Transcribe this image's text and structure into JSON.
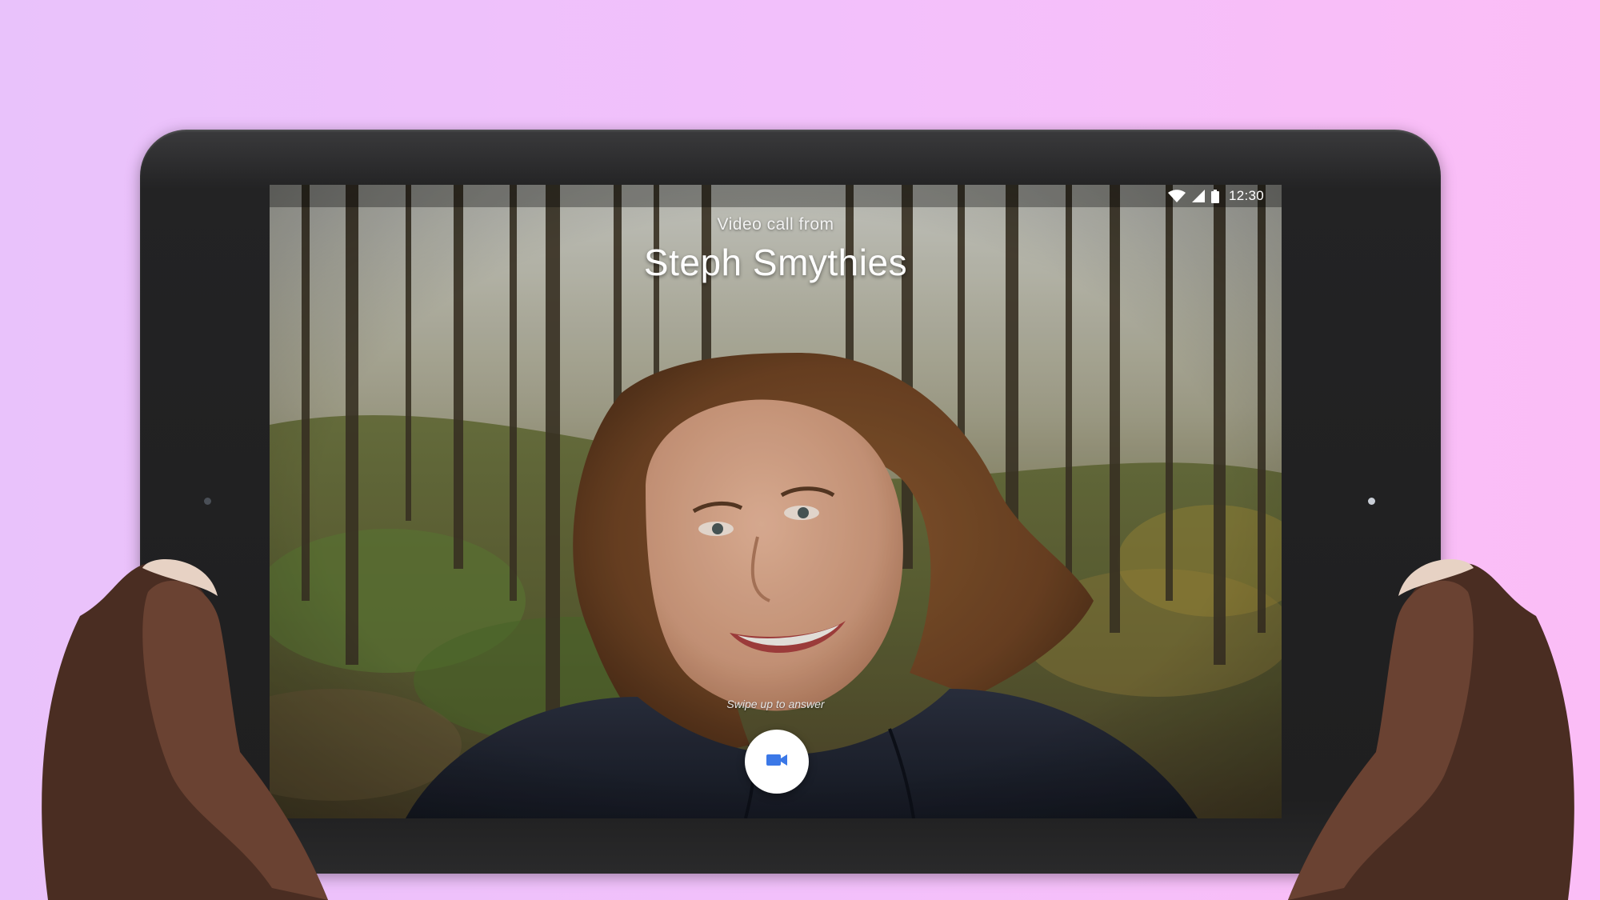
{
  "status_bar": {
    "time": "12:30",
    "icons": [
      "wifi-icon",
      "cellular-signal-icon",
      "battery-icon"
    ]
  },
  "incoming_call": {
    "subtitle": "Video call from",
    "caller_name": "Steph Smythies",
    "swipe_hint": "Swipe up to answer",
    "answer_icon": "videocam-icon"
  },
  "colors": {
    "background_left": "#e9c2fb",
    "background_right": "#fbbdf6",
    "tablet_bezel": "#1f1f20",
    "answer_button_bg": "#ffffff",
    "answer_icon": "#3b78e7"
  }
}
